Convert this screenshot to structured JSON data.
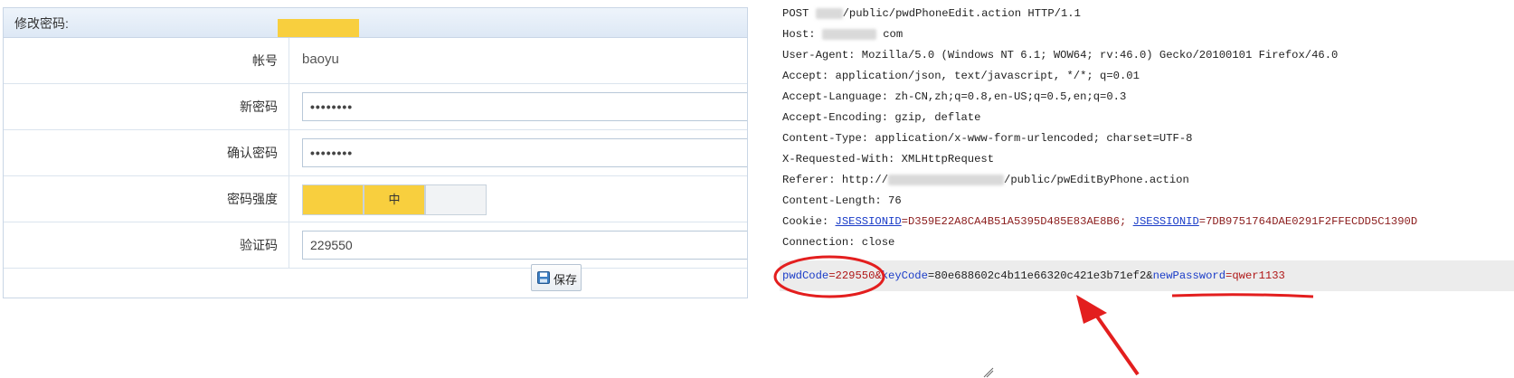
{
  "form": {
    "title": "修改密码:",
    "rows": [
      {
        "label": "帐号",
        "value": "baoyu"
      },
      {
        "label": "新密码",
        "value": "••••••••"
      },
      {
        "label": "确认密码",
        "value": "••••••••"
      },
      {
        "label": "密码强度",
        "value": ""
      },
      {
        "label": "验证码",
        "value": "229550"
      }
    ],
    "strength_levels": [
      "",
      "中",
      ""
    ],
    "save_label": "保存",
    "colors": {
      "highlight": "#f8cf3e",
      "border": "#c9d6e6"
    }
  },
  "http": {
    "request_line": {
      "method": "POST",
      "path": "/public/pwdPhoneEdit.action HTTP/1.1"
    },
    "host": {
      "key": "Host:",
      "tail": "com"
    },
    "user_agent": "User-Agent: Mozilla/5.0 (Windows NT 6.1; WOW64; rv:46.0) Gecko/20100101 Firefox/46.0",
    "accept": "Accept: application/json, text/javascript, */*; q=0.01",
    "accept_language": "Accept-Language: zh-CN,zh;q=0.8,en-US;q=0.5,en;q=0.3",
    "accept_encoding": "Accept-Encoding: gzip, deflate",
    "content_type": "Content-Type: application/x-www-form-urlencoded; charset=UTF-8",
    "x_requested_with": "X-Requested-With: XMLHttpRequest",
    "referer": {
      "key": "Referer: http://",
      "tail": "/public/pwEditByPhone.action"
    },
    "content_length": "Content-Length: 76",
    "cookie": {
      "key": "Cookie: ",
      "k1": "JSESSIONID",
      "v1": "=D359E22A8CA4B51A5395D485E83AE8B6;",
      "k2": "JSESSIONID",
      "v2": "=7DB9751764DAE0291F2FFECDD5C1390D"
    },
    "connection": "Connection: close",
    "body": {
      "k1": "pwdCode",
      "v1": "=229550&",
      "k2": "keyCode",
      "v2": "=80e688602c4b11e66320c421e3b71ef2&",
      "k3": "newPassword",
      "v3": "=qwer1133"
    }
  },
  "annotation_color": "#e31e1e"
}
